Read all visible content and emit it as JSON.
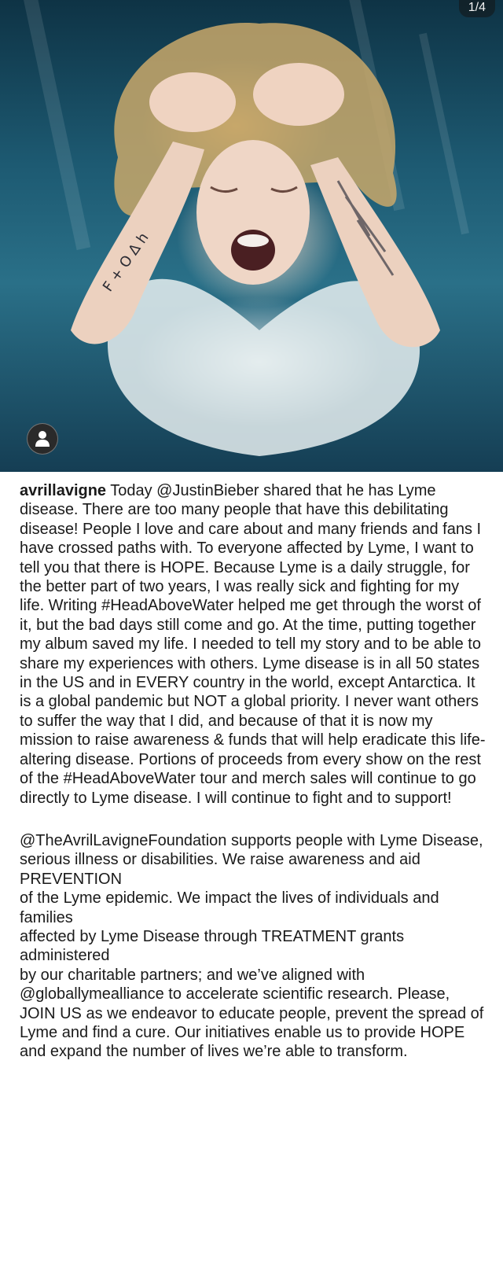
{
  "media": {
    "counter": "1/4",
    "alt": "underwater photo of a woman holding her head and screaming",
    "tattoo_text": "F + O Δ h"
  },
  "post": {
    "username": "avrillavigne",
    "caption_p1": " Today @JustinBieber shared that he has Lyme disease. There are too many people that have this debilitating disease! People I love and care about and many friends and fans I have crossed paths with. To everyone affected by Lyme, I want to tell you that there is HOPE. Because Lyme is a daily struggle, for the better part of two years, I was really sick and fighting for my life. Writing #HeadAboveWater helped me get through the worst of it, but the bad days still come and go. At the time, putting together my album saved my life. I needed to tell my story and to be able to share my experiences with others. Lyme disease is in all 50 states in the US and in EVERY country in the world, except Antarctica. It is a global pandemic but NOT a global priority. I never want others to suffer the way that I did, and because of that it is now my mission to raise awareness & funds that will help eradicate this life-altering disease. Portions of proceeds from every show on the rest of the #HeadAboveWater tour and merch sales will continue to go directly to Lyme disease. I will continue to fight and to support!",
    "caption_p2_lines": [
      "@TheAvrilLavigneFoundation supports people with Lyme Disease, serious illness or disabilities. We raise awareness and aid PREVENTION",
      "of the Lyme epidemic. We impact the lives of individuals and families",
      "affected by Lyme Disease through TREATMENT grants administered",
      "by our charitable partners; and we’ve aligned with @globallymealliance to accelerate scientific research. Please, JOIN US as we endeavor to educate people, prevent the spread of Lyme and find a cure. Our initiatives enable us to provide HOPE and expand the number of lives we’re able to transform."
    ]
  },
  "icons": {
    "avatar": "user-avatar-icon"
  },
  "colors": {
    "text": "#1a1a1a",
    "water_dark": "#0e3345",
    "water_light": "#2a7088"
  }
}
